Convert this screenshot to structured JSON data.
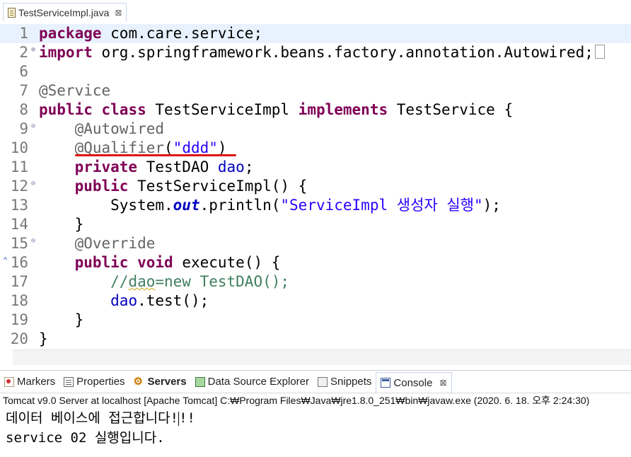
{
  "editor_tab": {
    "file_name": "TestServiceImpl.java",
    "close": "⊠"
  },
  "lines": [
    {
      "num": "1",
      "segments": [
        {
          "t": "package",
          "c": "kw"
        },
        {
          "t": " com.care.service;",
          "c": ""
        }
      ]
    },
    {
      "num": "2",
      "segments": [
        {
          "t": "import",
          "c": "kw"
        },
        {
          "t": " org.springframework.beans.factory.annotation.Autowired;",
          "c": ""
        }
      ]
    },
    {
      "num": "6",
      "segments": []
    },
    {
      "num": "7",
      "segments": [
        {
          "t": "@Service",
          "c": "ann"
        }
      ]
    },
    {
      "num": "8",
      "segments": [
        {
          "t": "public",
          "c": "kw"
        },
        {
          "t": " ",
          "c": ""
        },
        {
          "t": "class",
          "c": "kw"
        },
        {
          "t": " TestServiceImpl ",
          "c": ""
        },
        {
          "t": "implements",
          "c": "kw"
        },
        {
          "t": " TestService {",
          "c": ""
        }
      ]
    },
    {
      "num": "9",
      "segments": [
        {
          "t": "    ",
          "c": ""
        },
        {
          "t": "@Autowired",
          "c": "ann"
        }
      ]
    },
    {
      "num": "10",
      "segments": [
        {
          "t": "    ",
          "c": ""
        },
        {
          "t": "@Qualifier",
          "c": "ann"
        },
        {
          "t": "(",
          "c": ""
        },
        {
          "t": "\"ddd\"",
          "c": "str"
        },
        {
          "t": ")",
          "c": ""
        }
      ]
    },
    {
      "num": "11",
      "segments": [
        {
          "t": "    ",
          "c": ""
        },
        {
          "t": "private",
          "c": "kw"
        },
        {
          "t": " TestDAO ",
          "c": ""
        },
        {
          "t": "dao",
          "c": "fld"
        },
        {
          "t": ";",
          "c": ""
        }
      ]
    },
    {
      "num": "12",
      "segments": [
        {
          "t": "    ",
          "c": ""
        },
        {
          "t": "public",
          "c": "kw"
        },
        {
          "t": " TestServiceImpl() {",
          "c": ""
        }
      ]
    },
    {
      "num": "13",
      "segments": [
        {
          "t": "        System.",
          "c": ""
        },
        {
          "t": "out",
          "c": "sfld"
        },
        {
          "t": ".println(",
          "c": ""
        },
        {
          "t": "\"ServiceImpl 생성자 실행\"",
          "c": "str"
        },
        {
          "t": ");",
          "c": ""
        }
      ]
    },
    {
      "num": "14",
      "segments": [
        {
          "t": "    }",
          "c": ""
        }
      ]
    },
    {
      "num": "15",
      "segments": [
        {
          "t": "    ",
          "c": ""
        },
        {
          "t": "@Override",
          "c": "ann"
        }
      ]
    },
    {
      "num": "16",
      "segments": [
        {
          "t": "    ",
          "c": ""
        },
        {
          "t": "public",
          "c": "kw"
        },
        {
          "t": " ",
          "c": ""
        },
        {
          "t": "void",
          "c": "kw"
        },
        {
          "t": " execute() {",
          "c": ""
        }
      ]
    },
    {
      "num": "17",
      "segments": [
        {
          "t": "        //",
          "c": "cmt"
        },
        {
          "t": "dao",
          "c": "cmt squiggle"
        },
        {
          "t": "=new TestDAO();",
          "c": "cmt"
        }
      ]
    },
    {
      "num": "18",
      "segments": [
        {
          "t": "        ",
          "c": ""
        },
        {
          "t": "dao",
          "c": "fld"
        },
        {
          "t": ".test();",
          "c": ""
        }
      ]
    },
    {
      "num": "19",
      "segments": [
        {
          "t": "    }",
          "c": ""
        }
      ]
    },
    {
      "num": "20",
      "segments": [
        {
          "t": "}",
          "c": ""
        }
      ]
    }
  ],
  "panel_tabs": [
    {
      "id": "markers",
      "label": "Markers",
      "icon": "markers-icon"
    },
    {
      "id": "properties",
      "label": "Properties",
      "icon": "properties-icon"
    },
    {
      "id": "servers",
      "label": "Servers",
      "icon": "servers-icon"
    },
    {
      "id": "data-source-explorer",
      "label": "Data Source Explorer",
      "icon": "data-source-explorer-icon"
    },
    {
      "id": "snippets",
      "label": "Snippets",
      "icon": "snippets-icon"
    },
    {
      "id": "console",
      "label": "Console",
      "icon": "console-icon",
      "close": "⊠"
    }
  ],
  "console": {
    "header": "Tomcat v9.0 Server at localhost [Apache Tomcat] C:₩Program Files₩Java₩jre1.8.0_251₩bin₩javaw.exe  (2020. 6. 18. 오후 2:24:30)",
    "line1_a": "데이터 베이스에 접근합니다!",
    "line1_b": "!!",
    "line2": "service 02 실행입니다."
  },
  "colors": {
    "keyword": "#7f0055",
    "annotation": "#646464",
    "string": "#2a00ff",
    "field": "#0000c0",
    "comment": "#3f7f5f",
    "highlight": "#e11414"
  }
}
